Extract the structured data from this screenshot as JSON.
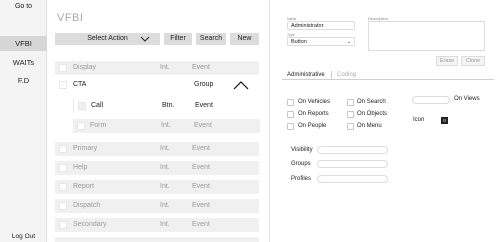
{
  "nav": {
    "goto": "Go to",
    "items": [
      {
        "label": "VFBI"
      },
      {
        "label": "WAITs"
      },
      {
        "label": "F.D"
      }
    ],
    "logout": "Log Out"
  },
  "list": {
    "title": "VFBI",
    "toolbar": {
      "select_action": "Select Action",
      "filter": "Filter",
      "search": "Search",
      "new": "New"
    },
    "rows": [
      {
        "name": "Display",
        "type": "Int.",
        "event": "Event"
      },
      {
        "name": "CTA",
        "type": "",
        "event": "Group"
      },
      {
        "name": "Call",
        "type": "Btn.",
        "event": "Event"
      },
      {
        "name": "Form",
        "type": "Int.",
        "event": "Event"
      },
      {
        "name": "Primary",
        "type": "Int.",
        "event": "Event"
      },
      {
        "name": "Help",
        "type": "Int.",
        "event": "Event"
      },
      {
        "name": "Report",
        "type": "Int.",
        "event": "Event"
      },
      {
        "name": "Dispatch",
        "type": "Int.",
        "event": "Event"
      },
      {
        "name": "Secondary",
        "type": "Int.",
        "event": "Event"
      }
    ]
  },
  "detail": {
    "name_small_label": "Name",
    "name_value": "Administrator",
    "type_small_label": "Type",
    "type_value": "Button",
    "description_label": "Description",
    "erase": "Erase",
    "clone": "Clone",
    "tabs": [
      "Administrative",
      "Coding"
    ],
    "checkboxes": [
      {
        "label": "On Vehicles"
      },
      {
        "label": "On Search"
      },
      {
        "label": "On Reports"
      },
      {
        "label": "On Objects"
      },
      {
        "label": "On People"
      },
      {
        "label": "On Menu"
      }
    ],
    "on_views_label": "On Views",
    "icon_label": "Icon",
    "icon_symbol": "☷",
    "fields": [
      {
        "label": "Visibility"
      },
      {
        "label": "Groups"
      },
      {
        "label": "Profiles"
      }
    ]
  }
}
